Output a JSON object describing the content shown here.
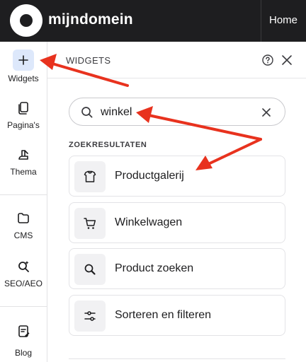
{
  "topbar": {
    "brand": "mijndomein",
    "home_label": "Home"
  },
  "rail": {
    "items": [
      {
        "label": "Widgets",
        "icon": "plus-icon"
      },
      {
        "label": "Pagina's",
        "icon": "pages-icon"
      },
      {
        "label": "Thema",
        "icon": "theme-icon"
      },
      {
        "label": "CMS",
        "icon": "folder-icon"
      },
      {
        "label": "SEO/AEO",
        "icon": "seo-search-icon"
      },
      {
        "label": "Blog",
        "icon": "blog-icon"
      }
    ]
  },
  "panel": {
    "title": "WIDGETS",
    "search": {
      "value": "winkel",
      "placeholder": ""
    },
    "section_label": "ZOEKRESULTATEN",
    "results": [
      {
        "label": "Productgalerij",
        "icon": "product-gallery-icon"
      },
      {
        "label": "Winkelwagen",
        "icon": "cart-icon"
      },
      {
        "label": "Product zoeken",
        "icon": "product-search-icon"
      },
      {
        "label": "Sorteren en filteren",
        "icon": "sort-filter-icon"
      }
    ]
  },
  "colors": {
    "topbar_bg": "#1e1e20",
    "accent_active_bg": "#dde8fb",
    "annotation_arrow": "#e8321e"
  }
}
